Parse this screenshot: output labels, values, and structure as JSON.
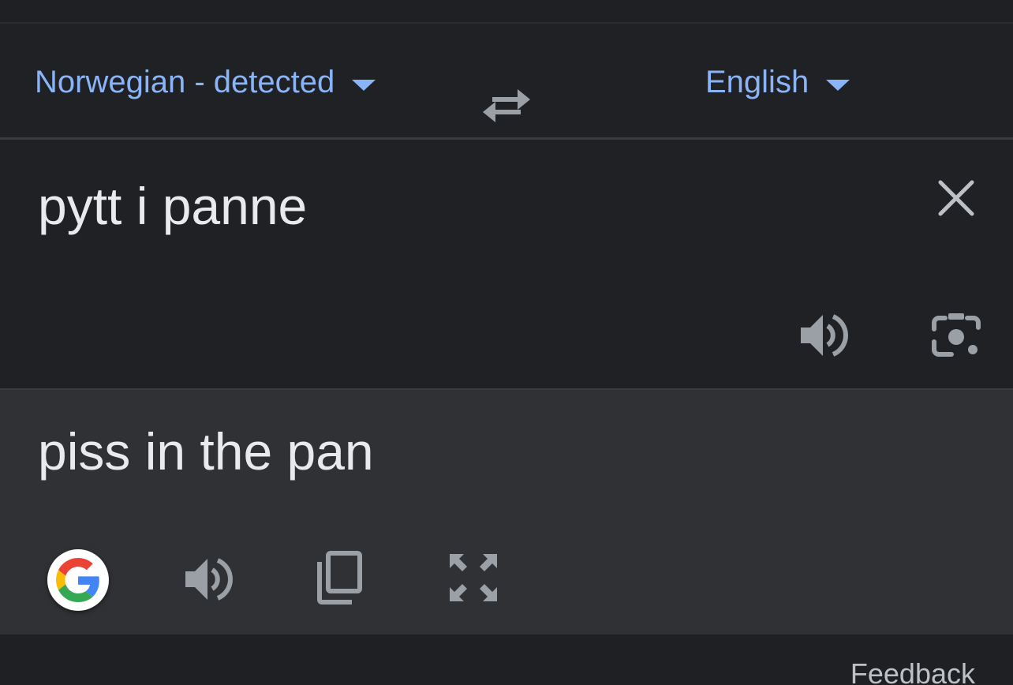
{
  "language_bar": {
    "source_language": "Norwegian - detected",
    "target_language": "English",
    "swap_icon": "swap-arrows-icon",
    "dropdown_icon": "caret-down-icon"
  },
  "input": {
    "text": "pytt i panne",
    "clear_icon": "close-icon",
    "listen_icon": "speaker-icon",
    "camera_icon": "camera-icon"
  },
  "output": {
    "text": "piss in the pan",
    "google_icon": "google-g-icon",
    "listen_icon": "speaker-icon",
    "copy_icon": "copy-icon",
    "fullscreen_icon": "fullscreen-icon"
  },
  "footer": {
    "feedback_label": "Feedback"
  },
  "colors": {
    "background": "#202124",
    "output_background": "#303134",
    "accent": "#8ab4f8",
    "text": "#e8eaed",
    "icon": "#9aa0a6"
  }
}
